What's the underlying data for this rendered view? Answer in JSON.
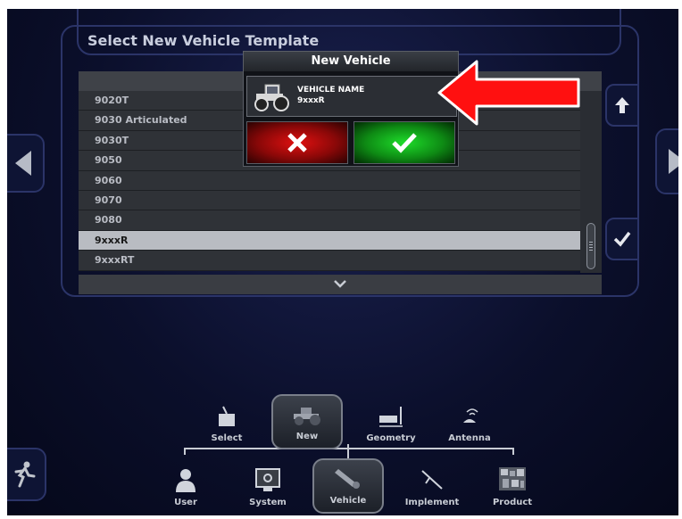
{
  "page": {
    "title": "Select New Vehicle Template"
  },
  "list": {
    "items": [
      "9020T",
      "9030 Articulated",
      "9030T",
      "9050",
      "9060",
      "9070",
      "9080",
      "9xxxR",
      "9xxxRT"
    ],
    "selected_index": 7
  },
  "dialog": {
    "title": "New Vehicle",
    "field_label": "VEHICLE NAME",
    "field_value": "9xxxR"
  },
  "nav": {
    "top": [
      {
        "label": "Select",
        "icon": "select-icon"
      },
      {
        "label": "New",
        "icon": "new-tractor-icon",
        "active": true
      },
      {
        "label": "Geometry",
        "icon": "geometry-icon"
      },
      {
        "label": "Antenna",
        "icon": "antenna-icon"
      }
    ],
    "bottom": [
      {
        "label": "User",
        "icon": "user-icon"
      },
      {
        "label": "System",
        "icon": "system-icon"
      },
      {
        "label": "Vehicle",
        "icon": "vehicle-icon",
        "active": true
      },
      {
        "label": "Implement",
        "icon": "implement-icon"
      },
      {
        "label": "Product",
        "icon": "product-icon"
      }
    ]
  },
  "colors": {
    "accent_red": "#e01010",
    "accent_green": "#1edc2a",
    "annotation_arrow": "#ff0000"
  }
}
